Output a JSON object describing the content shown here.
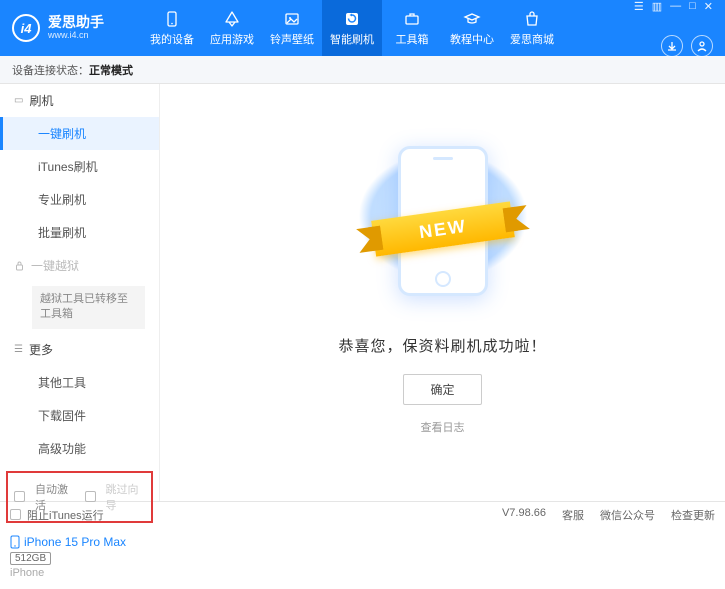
{
  "header": {
    "app_name": "爱思助手",
    "app_url": "www.i4.cn",
    "nav": [
      {
        "label": "我的设备"
      },
      {
        "label": "应用游戏"
      },
      {
        "label": "铃声壁纸"
      },
      {
        "label": "智能刷机"
      },
      {
        "label": "工具箱"
      },
      {
        "label": "教程中心"
      },
      {
        "label": "爱思商城"
      }
    ]
  },
  "status": {
    "prefix": "设备连接状态：",
    "value": "正常模式"
  },
  "sidebar": {
    "flash_section": "刷机",
    "items": [
      {
        "label": "一键刷机"
      },
      {
        "label": "iTunes刷机"
      },
      {
        "label": "专业刷机"
      },
      {
        "label": "批量刷机"
      }
    ],
    "jailbreak_section": "一键越狱",
    "jailbreak_note": "越狱工具已转移至工具箱",
    "more_section": "更多",
    "more_items": [
      {
        "label": "其他工具"
      },
      {
        "label": "下载固件"
      },
      {
        "label": "高级功能"
      }
    ],
    "checks": {
      "auto_activate": "自动激活",
      "skip_guide": "跳过向导"
    },
    "device": {
      "name": "iPhone 15 Pro Max",
      "storage": "512GB",
      "type": "iPhone"
    }
  },
  "content": {
    "ribbon": "NEW",
    "success_msg": "恭喜您，保资料刷机成功啦！",
    "ok_button": "确定",
    "view_log": "查看日志"
  },
  "footer": {
    "block_itunes": "阻止iTunes运行",
    "version": "V7.98.66",
    "links": [
      "客服",
      "微信公众号",
      "检查更新"
    ]
  }
}
